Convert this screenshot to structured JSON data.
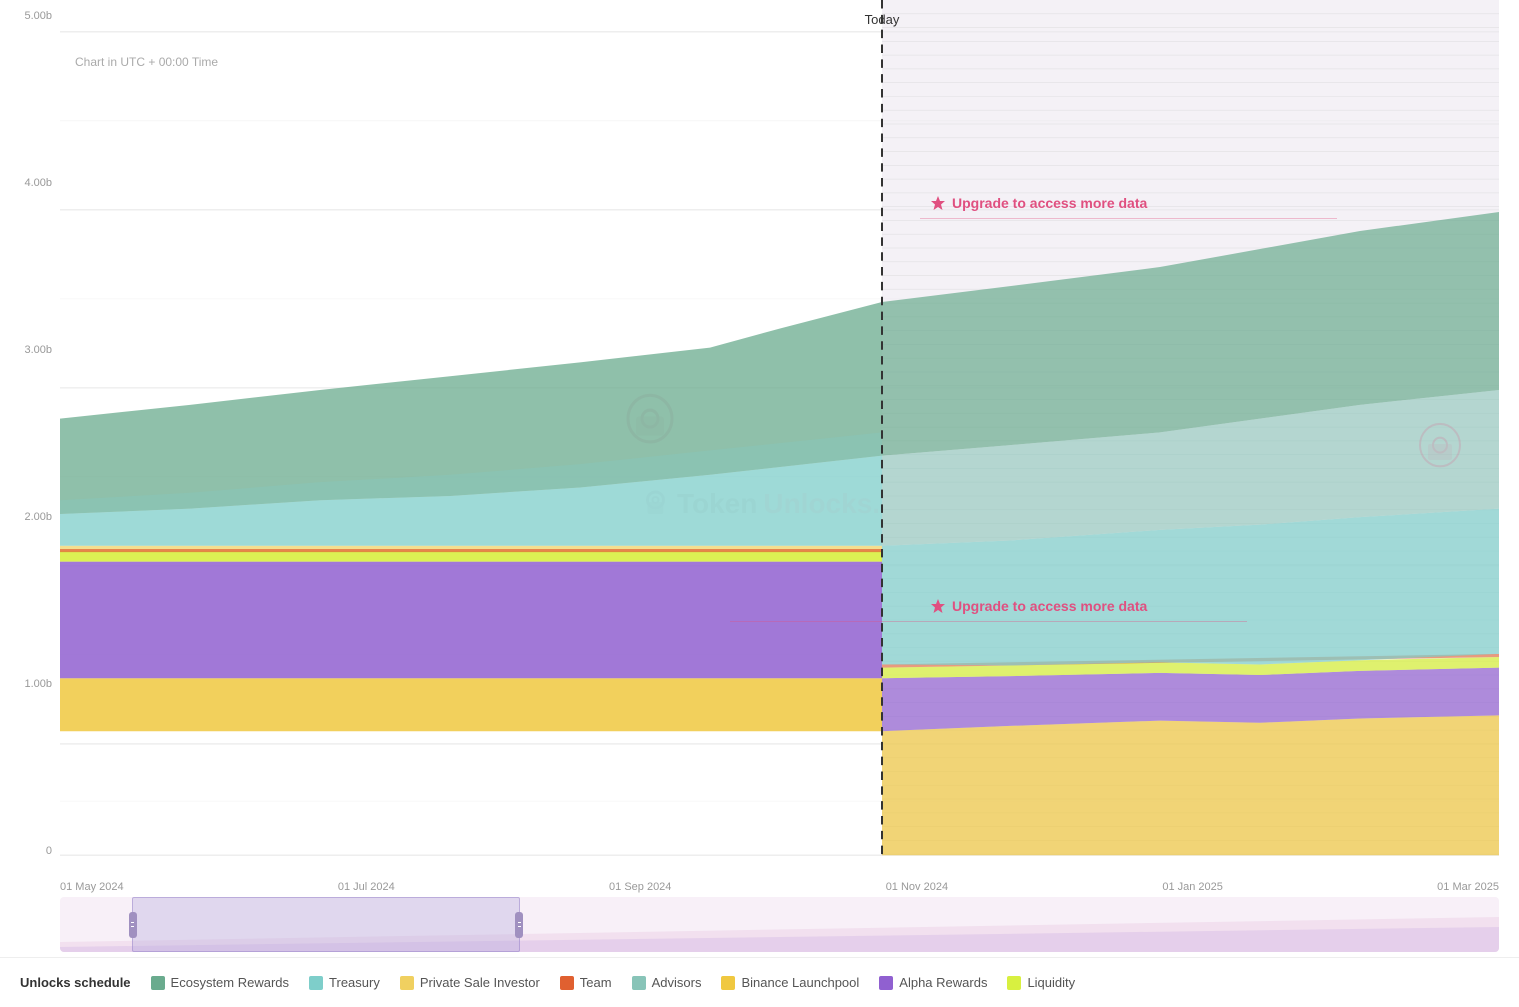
{
  "chart": {
    "title": "Unlocks schedule",
    "subtitle": "Chart in UTC + 00:00 Time",
    "today_label": "Today",
    "watermark": "TokenUnlocks.",
    "upgrade_text_1": "Upgrade to access more data",
    "upgrade_text_2": "Upgrade to access more data",
    "y_labels": [
      "5.00b",
      "4.00b",
      "3.00b",
      "2.00b",
      "1.00b",
      "0"
    ],
    "x_labels": [
      "01 May 2024",
      "01 Jul 2024",
      "01 Sep 2024",
      "01 Nov 2024",
      "01 Jan 2025",
      "01 Mar 2025"
    ]
  },
  "legend": {
    "items": [
      {
        "label": "Unlocks schedule",
        "color": null,
        "type": "title"
      },
      {
        "label": "Ecosystem Rewards",
        "color": "#6aab8e"
      },
      {
        "label": "Treasury",
        "color": "#7ececa"
      },
      {
        "label": "Private Sale Investor",
        "color": "#f0d060"
      },
      {
        "label": "Team",
        "color": "#e06030"
      },
      {
        "label": "Advisors",
        "color": "#88c4b8"
      },
      {
        "label": "Binance Launchpool",
        "color": "#f0c840"
      },
      {
        "label": "Alpha Rewards",
        "color": "#9060d0"
      },
      {
        "label": "Liquidity",
        "color": "#d8f040"
      }
    ]
  }
}
